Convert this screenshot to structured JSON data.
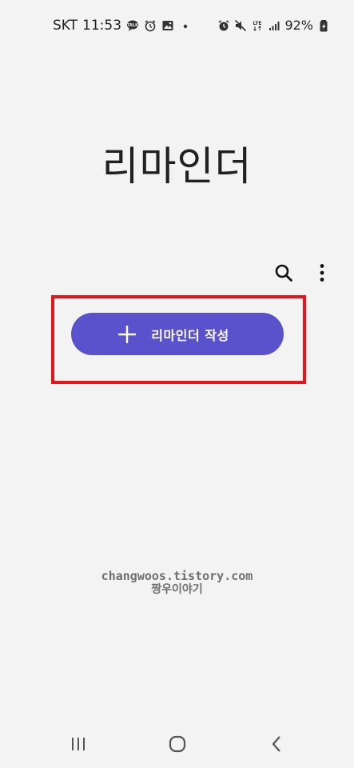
{
  "status_bar": {
    "carrier": "SKT",
    "time": "11:53",
    "network": "LTE",
    "battery": "92%",
    "left_icons": [
      "talk-icon",
      "alarm-icon",
      "image-icon",
      "dot-icon"
    ],
    "right_icons": [
      "alarm-icon",
      "mute-icon",
      "lte-icon",
      "signal-icon",
      "battery-icon"
    ]
  },
  "header": {
    "title": "리마인더"
  },
  "toolbar": {
    "icons": [
      "search-icon",
      "more-options-icon"
    ]
  },
  "create_button": {
    "label": "리마인더 작성",
    "icon": "plus-icon",
    "color": "#5a52cc"
  },
  "highlight": {
    "color": "#e8141b"
  },
  "watermark": {
    "url": "changwoos.tistory.com",
    "name": "짱우이야기"
  },
  "nav_bar": {
    "icons": [
      "recent-apps-icon",
      "home-icon",
      "back-icon"
    ]
  }
}
